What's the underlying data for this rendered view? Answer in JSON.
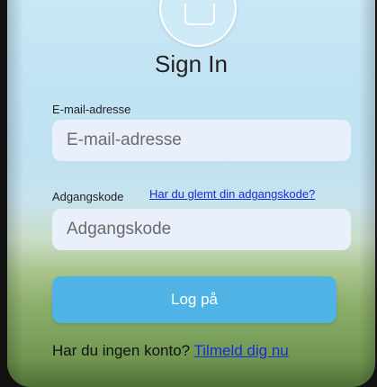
{
  "header": {
    "title": "Sign In",
    "logo_icon": "app-logo-icon"
  },
  "email": {
    "label": "E-mail-adresse",
    "placeholder": "E-mail-adresse",
    "value": ""
  },
  "password": {
    "label": "Adgangskode",
    "placeholder": "Adgangskode",
    "value": "",
    "forgot_link": "Har du glemt din adgangskode?"
  },
  "actions": {
    "login_label": "Log på"
  },
  "signup": {
    "prompt": "Har du ingen konto?",
    "link": "Tilmeld dig nu"
  },
  "colors": {
    "accent": "#4fb3e6",
    "link": "#1b2bd6",
    "field_bg": "#e9f0fb"
  }
}
